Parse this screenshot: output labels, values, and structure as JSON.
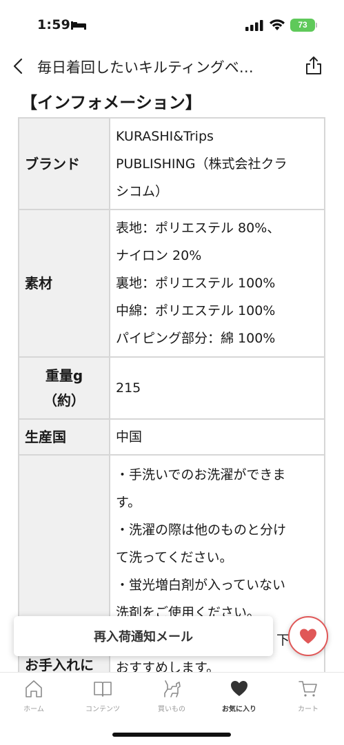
{
  "status_bar": {
    "time": "1:59",
    "battery": "73"
  },
  "navbar": {
    "title": "毎日着回したいキルティングベ…"
  },
  "section_title": "【インフォメーション】",
  "info_rows": [
    {
      "label": "ブランド",
      "lines": [
        "KURASHI&Trips",
        "PUBLISHING（株式会社クラ",
        "シコム）"
      ]
    },
    {
      "label": "素材",
      "lines": [
        "表地：ポリエステル 80%、",
        "ナイロン 20%",
        "裏地：ポリエステル 100%",
        "中綿：ポリエステル 100%",
        "パイピング部分：綿 100%"
      ]
    },
    {
      "label_lines": [
        "重量g",
        "（約）"
      ],
      "lines": [
        "215"
      ]
    },
    {
      "label": "生産国",
      "lines": [
        "中国"
      ]
    },
    {
      "label": "お手入れに",
      "lines": [
        "・手洗いでのお洗濯ができま",
        "す。",
        "・洗濯の際は他のものと分け",
        "て洗ってください。",
        "・蛍光増白剤が入っていない",
        "洗剤をご使用ください。",
        "下",
        "おすすめします。"
      ]
    }
  ],
  "restock_button": "再入荷通知メール",
  "tabbar": [
    {
      "label": "ホーム",
      "icon": "home-icon"
    },
    {
      "label": "コンテンツ",
      "icon": "book-icon"
    },
    {
      "label": "買いもの",
      "icon": "shopping-dog-icon"
    },
    {
      "label": "お気に入り",
      "icon": "heart-icon",
      "active": true
    },
    {
      "label": "カート",
      "icon": "cart-icon"
    }
  ],
  "colors": {
    "accent_red": "#e05757",
    "battery_green": "#5fc95a",
    "table_head_bg": "#f0f0f0",
    "table_border": "#d6d6d6"
  }
}
